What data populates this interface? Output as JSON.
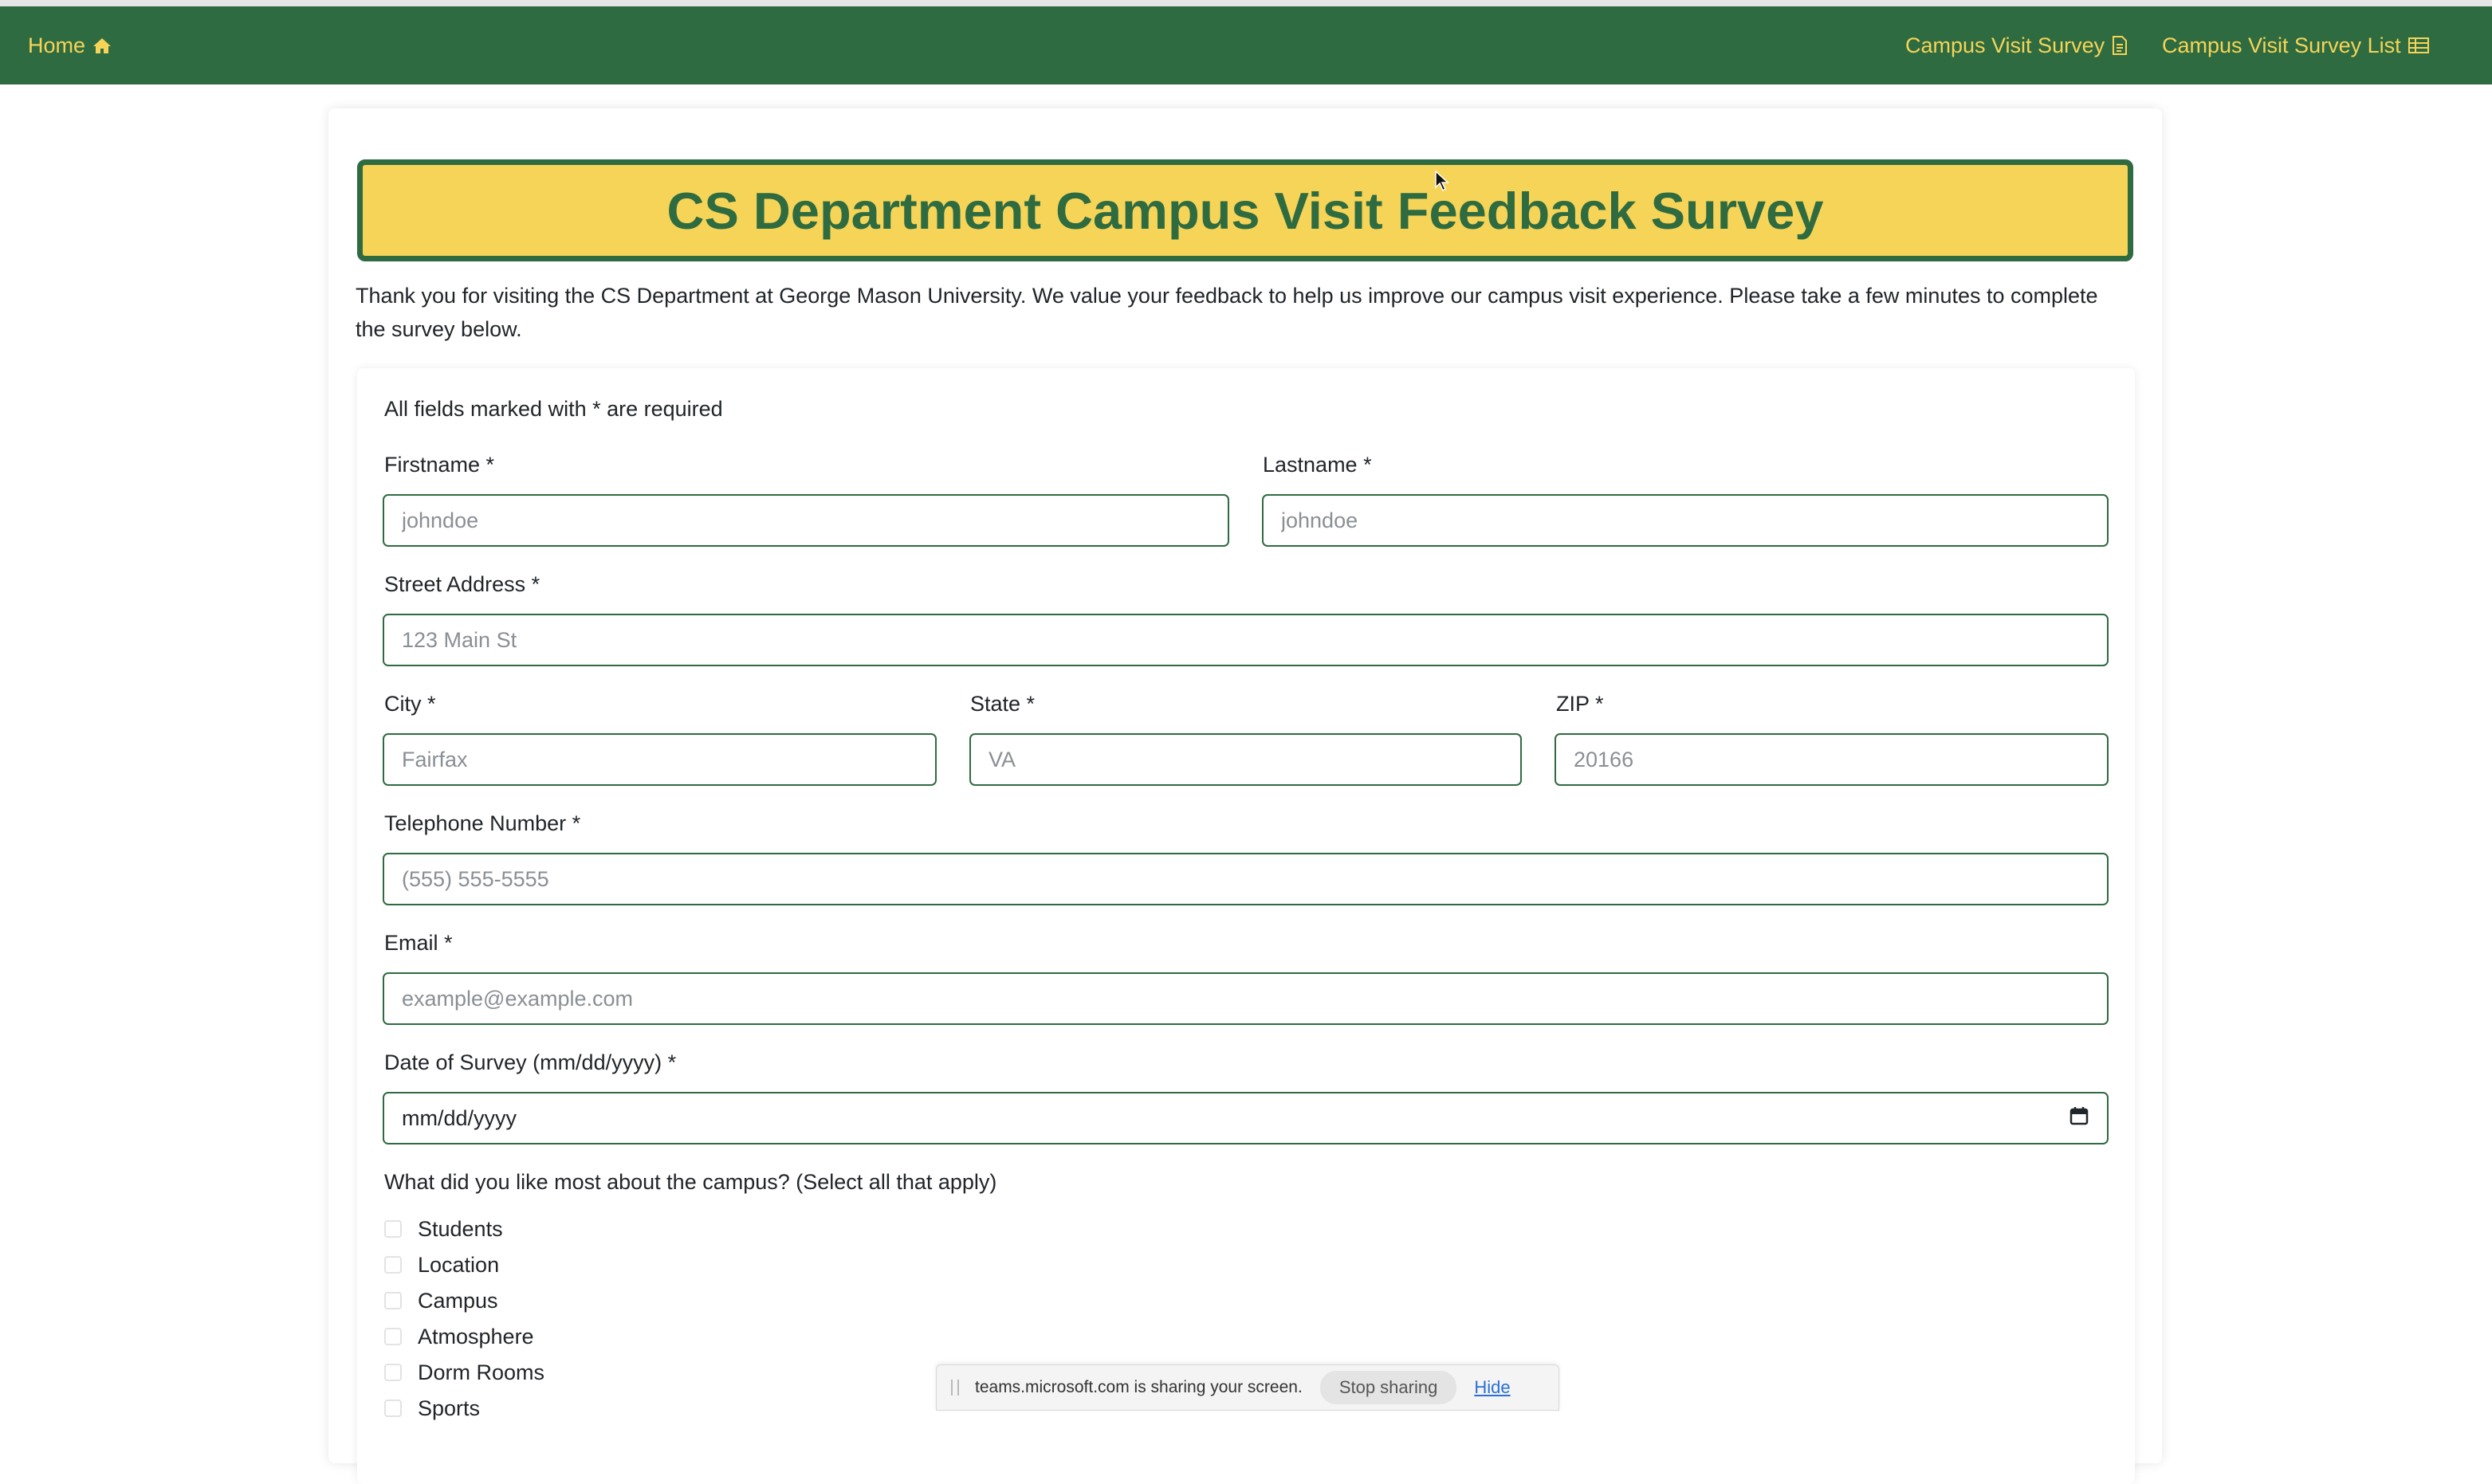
{
  "nav": {
    "home_label": "Home",
    "survey_label": "Campus Visit Survey",
    "list_label": "Campus Visit Survey List",
    "bg_color": "#2f6b40",
    "link_color": "#f6d458"
  },
  "header": {
    "title": "CS Department Campus Visit Feedback Survey",
    "intro": "Thank you for visiting the CS Department at George Mason University. We value your feedback to help us improve our campus visit experience. Please take a few minutes to complete the survey below."
  },
  "form": {
    "required_note": "All fields marked with * are required",
    "firstname": {
      "label": "Firstname *",
      "placeholder": "johndoe",
      "value": ""
    },
    "lastname": {
      "label": "Lastname *",
      "placeholder": "johndoe",
      "value": ""
    },
    "street": {
      "label": "Street Address *",
      "placeholder": "123 Main St",
      "value": ""
    },
    "city": {
      "label": "City *",
      "placeholder": "Fairfax",
      "value": ""
    },
    "state": {
      "label": "State *",
      "placeholder": "VA",
      "value": ""
    },
    "zip": {
      "label": "ZIP *",
      "placeholder": "20166",
      "value": ""
    },
    "phone": {
      "label": "Telephone Number *",
      "placeholder": "(555) 555-5555",
      "value": ""
    },
    "email": {
      "label": "Email *",
      "placeholder": "example@example.com",
      "value": ""
    },
    "date": {
      "label": "Date of Survey (mm/dd/yyyy) *",
      "display": "mm/dd/yyyy"
    },
    "likes_question": "What did you like most about the campus? (Select all that apply)",
    "likes_options": [
      "Students",
      "Location",
      "Campus",
      "Atmosphere",
      "Dorm Rooms",
      "Sports"
    ]
  },
  "share_bar": {
    "message": "teams.microsoft.com is sharing your screen.",
    "stop_label": "Stop sharing",
    "hide_label": "Hide"
  },
  "icons": {
    "home": "home-icon",
    "survey": "document-icon",
    "list": "table-icon",
    "calendar": "calendar-icon"
  }
}
